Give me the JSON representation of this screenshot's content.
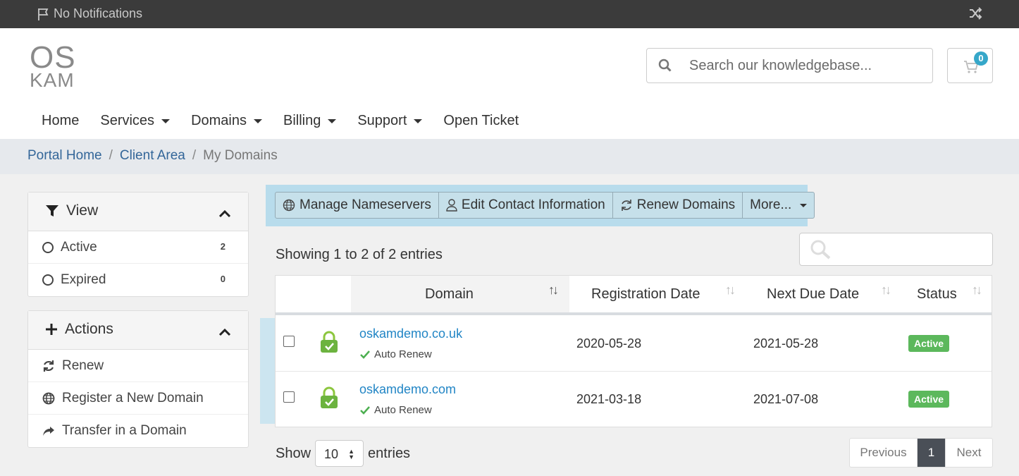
{
  "topbar": {
    "notifications": "No Notifications"
  },
  "logo": {
    "line1": "OS",
    "line2": "KAM"
  },
  "search": {
    "placeholder": "Search our knowledgebase..."
  },
  "cart": {
    "count": "0"
  },
  "nav": [
    {
      "label": "Home",
      "dropdown": false
    },
    {
      "label": "Services",
      "dropdown": true
    },
    {
      "label": "Domains",
      "dropdown": true
    },
    {
      "label": "Billing",
      "dropdown": true
    },
    {
      "label": "Support",
      "dropdown": true
    },
    {
      "label": "Open Ticket",
      "dropdown": false
    }
  ],
  "breadcrumb": {
    "home": "Portal Home",
    "area": "Client Area",
    "current": "My Domains"
  },
  "view_panel": {
    "title": "View",
    "items": [
      {
        "label": "Active",
        "count": "2"
      },
      {
        "label": "Expired",
        "count": "0"
      }
    ]
  },
  "actions_panel": {
    "title": "Actions",
    "items": [
      {
        "label": "Renew"
      },
      {
        "label": "Register a New Domain"
      },
      {
        "label": "Transfer in a Domain"
      }
    ]
  },
  "toolbar": {
    "manage_ns": "Manage Nameservers",
    "edit_contact": "Edit Contact Information",
    "renew": "Renew Domains",
    "more": "More..."
  },
  "table": {
    "showing": "Showing 1 to 2 of 2 entries",
    "headers": {
      "domain": "Domain",
      "reg": "Registration Date",
      "due": "Next Due Date",
      "status": "Status"
    },
    "rows": [
      {
        "domain": "oskamdemo.co.uk",
        "auto": "Auto Renew",
        "reg": "2020-05-28",
        "due": "2021-05-28",
        "status": "Active"
      },
      {
        "domain": "oskamdemo.com",
        "auto": "Auto Renew",
        "reg": "2021-03-18",
        "due": "2021-07-08",
        "status": "Active"
      }
    ]
  },
  "footer": {
    "show": "Show",
    "entries": "entries",
    "page_size": "10",
    "prev": "Previous",
    "page": "1",
    "next": "Next"
  },
  "colors": {
    "accent": "#2185c5",
    "active": "#5cb85c",
    "topbar": "#3b3b3b",
    "badge": "#36a7c9"
  }
}
